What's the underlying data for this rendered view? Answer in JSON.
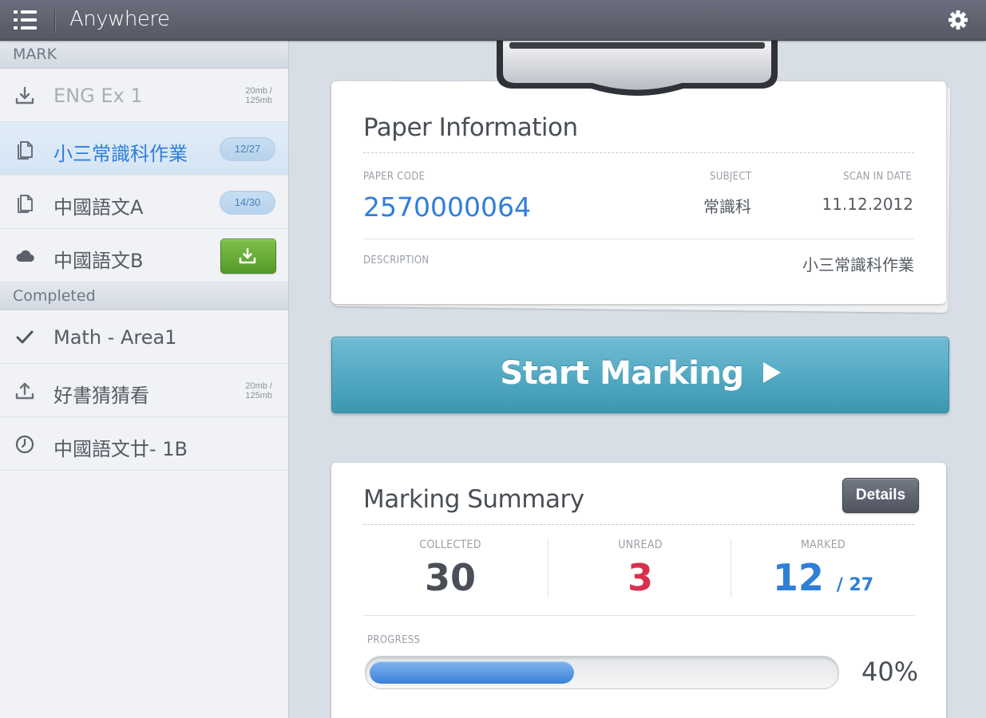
{
  "header": {
    "title": "Anywhere"
  },
  "sidebar": {
    "sections": [
      {
        "title": "MARK",
        "items": [
          {
            "label": "ENG Ex 1",
            "icon": "download-icon",
            "size_line1": "20mb /",
            "size_line2": "125mb",
            "state": "dim"
          },
          {
            "label": "小三常識科作業",
            "icon": "document-icon",
            "badge": "12/27",
            "state": "active"
          },
          {
            "label": "中國語文A",
            "icon": "document-icon",
            "badge": "14/30"
          },
          {
            "label": "中國語文B",
            "icon": "cloud-icon",
            "action": "download"
          }
        ]
      },
      {
        "title": "Completed",
        "items": [
          {
            "label": "Math - Area1",
            "icon": "checkmark-icon"
          },
          {
            "label": "好書猜猜看",
            "icon": "upload-icon",
            "size_line1": "20mb /",
            "size_line2": "125mb"
          },
          {
            "label": "中國語文廿- 1B",
            "icon": "clock-icon"
          }
        ]
      }
    ]
  },
  "paper_info": {
    "title": "Paper Information",
    "paper_code_label": "PAPER CODE",
    "paper_code": "2570000064",
    "subject_label": "SUBJECT",
    "subject": "常識科",
    "scan_date_label": "SCAN IN DATE",
    "scan_date": "11.12.2012",
    "description_label": "DESCRIPTION",
    "description": "小三常識科作業"
  },
  "start_button": {
    "label": "Start Marking"
  },
  "summary": {
    "title": "Marking Summary",
    "details_label": "Details",
    "collected_label": "COLLECTED",
    "collected": "30",
    "unread_label": "UNREAD",
    "unread": "3",
    "marked_label": "MARKED",
    "marked": "12",
    "marked_total": "/ 27",
    "progress_label": "PROGRESS",
    "progress_text": "40%",
    "progress_fraction": 0.44
  },
  "colors": {
    "accent_blue": "#2f7fd9",
    "unread_red": "#d9304f",
    "start_button": "#4aa6c0",
    "download_green": "#66aa35"
  }
}
